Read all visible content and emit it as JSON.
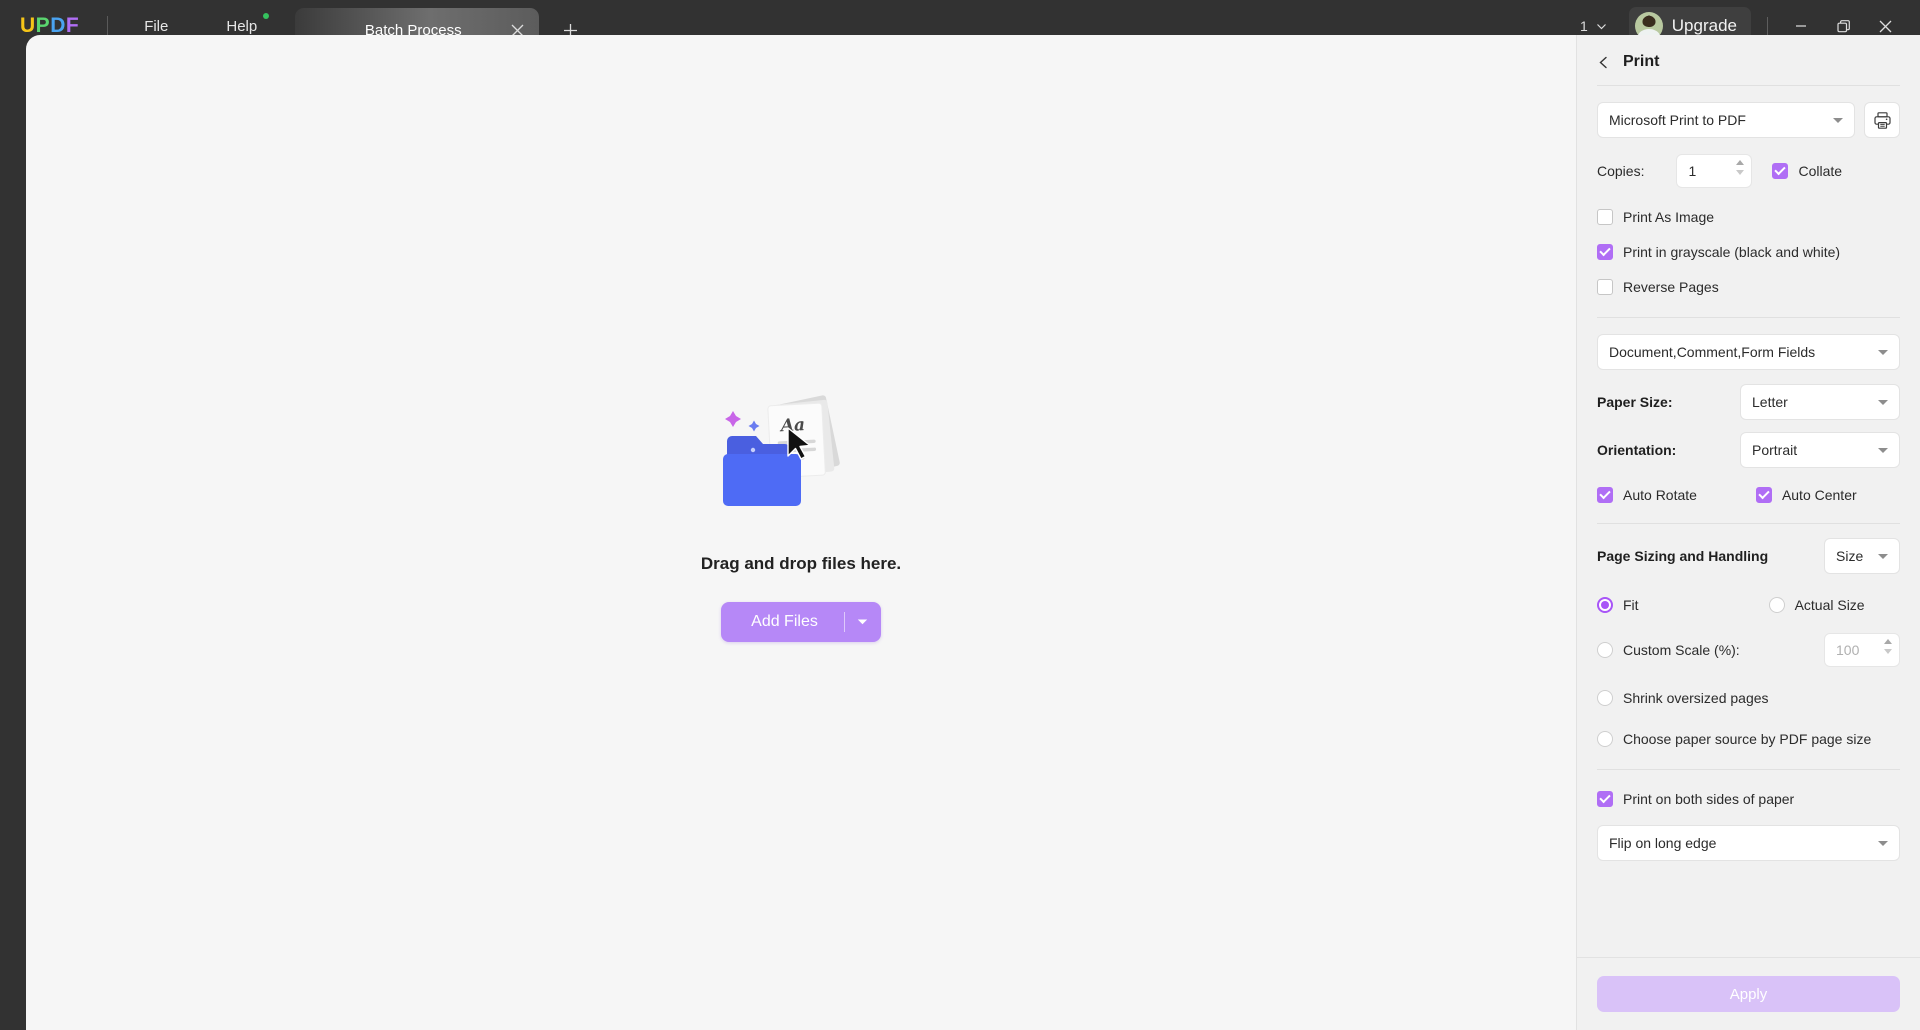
{
  "titlebar": {
    "logo": [
      "U",
      "P",
      "D",
      "F"
    ],
    "menus": [
      {
        "label": "File",
        "badge": false
      },
      {
        "label": "Help",
        "badge": true
      }
    ],
    "tab": {
      "label": "Batch Process",
      "close_icon": "close-icon"
    },
    "add_tab_icon": "plus-icon",
    "page_count": "1",
    "upgrade_label": "Upgrade",
    "window_controls": [
      "minimize-icon",
      "maximize-icon",
      "close-icon"
    ]
  },
  "main": {
    "drop_text": "Drag and drop files here.",
    "add_files_label": "Add Files"
  },
  "panel": {
    "title": "Print",
    "back_icon": "chevron-left-icon",
    "printer": {
      "value": "Microsoft Print to PDF",
      "icon": "printer-icon"
    },
    "copies": {
      "label": "Copies:",
      "value": "1"
    },
    "collate": {
      "label": "Collate",
      "checked": true
    },
    "options": [
      {
        "label": "Print As Image",
        "checked": false
      },
      {
        "label": "Print in grayscale (black and white)",
        "checked": true
      },
      {
        "label": "Reverse Pages",
        "checked": false
      }
    ],
    "content_select": "Document,Comment,Form Fields",
    "paper_size": {
      "label": "Paper Size:",
      "value": "Letter"
    },
    "orientation": {
      "label": "Orientation:",
      "value": "Portrait"
    },
    "auto_rotate": {
      "label": "Auto Rotate",
      "checked": true
    },
    "auto_center": {
      "label": "Auto Center",
      "checked": true
    },
    "page_sizing": {
      "label": "Page Sizing and Handling",
      "mode": "Size"
    },
    "scale_options": [
      {
        "label": "Fit",
        "selected": true
      },
      {
        "label": "Actual Size",
        "selected": false
      },
      {
        "label": "Custom Scale (%):",
        "selected": false
      },
      {
        "label": "Shrink oversized pages",
        "selected": false
      },
      {
        "label": "Choose paper source by PDF page size",
        "selected": false
      }
    ],
    "custom_scale_value": "100",
    "duplex": {
      "label": "Print on both sides of paper",
      "checked": true
    },
    "duplex_mode": "Flip on long edge",
    "apply_label": "Apply"
  },
  "colors": {
    "accent": "#b06ef5",
    "accent_light": "#b688f7",
    "apply_disabled": "#d9c2f8",
    "titlebar": "#323232",
    "content_bg": "#f6f6f6",
    "panel_bg": "#f1f1f1",
    "badge_green": "#35c25e"
  }
}
